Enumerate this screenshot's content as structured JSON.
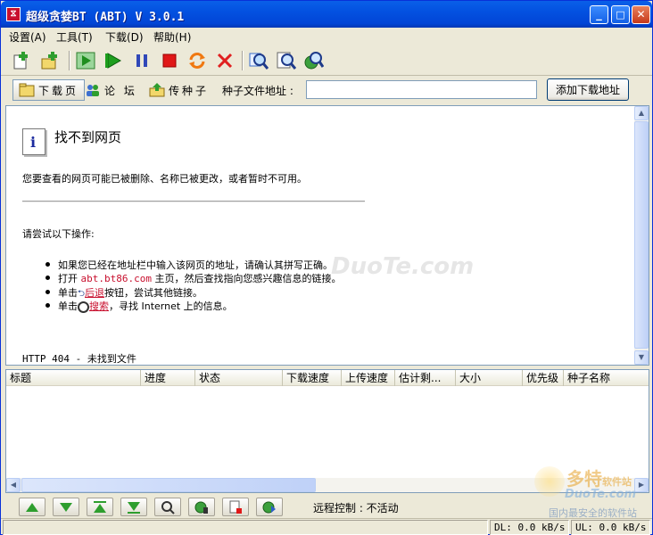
{
  "window": {
    "title": "超级贪婪BT (ABT) V 3.0.1",
    "min": "_",
    "max": "□",
    "close": "✕"
  },
  "menu": [
    "设置(A)",
    "工具(T)",
    "下载(D)",
    "帮助(H)"
  ],
  "nav": {
    "download_label": "下载页",
    "forum_label": "论 坛",
    "upload_label": "传种子"
  },
  "seed": {
    "label": "种子文件地址 :",
    "value": "",
    "add_button": "添加下载地址"
  },
  "page": {
    "title": "找不到网页",
    "description": "您要查看的网页可能已被删除、名称已被更改，或者暂时不可用。",
    "try_label": "请尝试以下操作:",
    "bullet1": "如果您已经在地址栏中输入该网页的地址，请确认其拼写正确。",
    "bullet2_prefix": "打开",
    "bullet2_link": "abt.bt86.com",
    "bullet2_suffix": "主页，然后查找指向您感兴趣信息的链接。",
    "bullet3_prefix": "单击",
    "bullet3_link": "后退",
    "bullet3_suffix": "按钮，尝试其他链接。",
    "bullet4_prefix": "单击",
    "bullet4_link": "搜索",
    "bullet4_suffix": "，寻找 Internet 上的信息。",
    "http_status": "HTTP 404 - 未找到文件"
  },
  "table": {
    "columns": [
      "标题",
      "进度",
      "状态",
      "下载速度",
      "上传速度",
      "估计剩...",
      "大小",
      "优先级",
      "种子名称"
    ]
  },
  "bottom": {
    "remote_control": "远程控制 : 不活动"
  },
  "status": {
    "dl": "DL: 0.0 kB/s",
    "ul": "UL: 0.0 kB/s"
  },
  "watermark": {
    "brand_cn": "多特",
    "brand_sub": "软件站",
    "brand_en": "DuoTe.com",
    "tagline": "国内最安全的软件站",
    "center": "DuoTe.com"
  },
  "colors": {
    "titlebar": "#0351E0",
    "link": "#C8102E",
    "accent_green": "#2E9E2E"
  }
}
